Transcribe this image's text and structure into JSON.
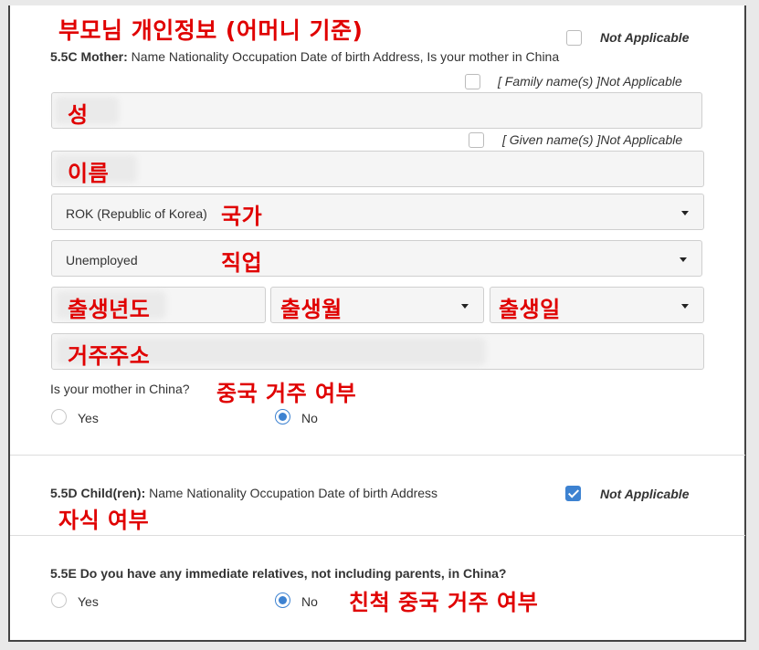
{
  "annotations": {
    "section_title": "부모님 개인정보 (어머니 기준)",
    "surname": "성",
    "given": "이름",
    "nationality": "국가",
    "occupation": "직업",
    "birth_year": "출생년도",
    "birth_month": "출생월",
    "birth_day": "출생일",
    "address": "거주주소",
    "in_china": "중국 거주 여부",
    "children": "자식 여부",
    "relatives": "친척 중국 거주 여부"
  },
  "mother": {
    "not_applicable": "Not Applicable",
    "heading_bold": "5.5C Mother:",
    "heading_text": " Name Nationality Occupation Date of birth Address, Is your mother in China",
    "family_na": "[ Family name(s) ]Not Applicable",
    "given_na": "[ Given name(s) ]Not Applicable",
    "nationality_value": "ROK (Republic of Korea)",
    "occupation_value": "Unemployed",
    "in_china_question": "Is your mother in China?",
    "yes_label": "Yes",
    "no_label": "No"
  },
  "children": {
    "heading_bold": "5.5D Child(ren):",
    "heading_text": " Name Nationality Occupation Date of birth Address",
    "not_applicable": "Not Applicable"
  },
  "relatives": {
    "question": "5.5E Do you have any immediate relatives, not including parents, in China?",
    "yes_label": "Yes",
    "no_label": "No"
  },
  "colors": {
    "accent": "#3d82d1",
    "annotation": "#e00000"
  }
}
